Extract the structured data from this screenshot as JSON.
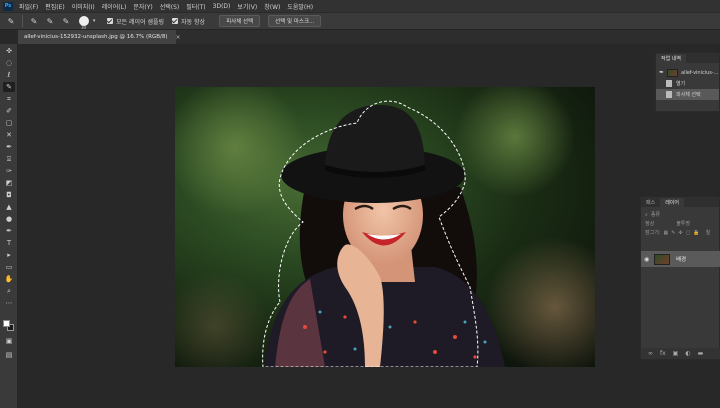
{
  "app": {
    "logo": "Ps"
  },
  "menu": [
    "파일(F)",
    "편집(E)",
    "이미지(I)",
    "레이어(L)",
    "문자(Y)",
    "선택(S)",
    "필터(T)",
    "3D(D)",
    "보기(V)",
    "창(W)",
    "도움말(H)"
  ],
  "options": {
    "brush_size": "30",
    "sample_all_layers_label": "모든 레이어 샘플링",
    "auto_enhance_label": "자동 향상",
    "select_subject_label": "피사체 선택",
    "select_and_mask_label": "선택 및 마스크..."
  },
  "document": {
    "tab_title": "allef-vinicius-152932-unsplash.jpg @ 16.7% (RGB/8)",
    "close_glyph": "×"
  },
  "history_panel": {
    "tab": "작업 내역",
    "snapshot": "allef-vinicius-...",
    "items": [
      {
        "label": "열기"
      },
      {
        "label": "피사체 선택"
      }
    ]
  },
  "layers_panel": {
    "tabs": [
      "패스",
      "레이어"
    ],
    "filter_label": "종류",
    "blend_label": "정상",
    "opacity_label": "불투명",
    "lock_label": "잠그기:",
    "fill_label": "칠",
    "layer_name": "배경",
    "footer_icons": [
      "link-icon",
      "fx-icon",
      "mask-icon",
      "adjustment-icon",
      "group-icon",
      "new-layer-icon",
      "trash-icon"
    ],
    "fx_glyph": "fx"
  },
  "colors": {
    "foreground": "#ffffff",
    "background": "#1b1b1b",
    "accent": "#31a8ff"
  }
}
